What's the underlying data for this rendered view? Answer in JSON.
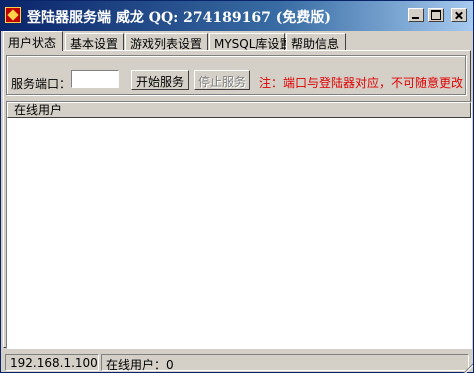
{
  "window": {
    "title": "登陆器服务端 威龙 QQ: 274189167 (免费版)"
  },
  "tabs": [
    {
      "label": "用户状态",
      "active": true
    },
    {
      "label": "基本设置",
      "active": false
    },
    {
      "label": "游戏列表设置",
      "active": false
    },
    {
      "label": "MYSQL库设置",
      "active": false
    },
    {
      "label": "帮助信息",
      "active": false
    }
  ],
  "server": {
    "port_label": "服务端口：",
    "port_value": "",
    "start_button": "开始服务",
    "stop_button": "停止服务",
    "stop_enabled": false,
    "note": "注：端口与登陆器对应，不可随意更改"
  },
  "online_list": {
    "columns": [
      "在线用户"
    ],
    "rows": []
  },
  "statusbar": {
    "ip": "192.168.1.100",
    "online_users": "在线用户：0"
  },
  "colors": {
    "titlebar_start": "#0a246a",
    "titlebar_end": "#a6caf0",
    "note_text": "#e00000"
  },
  "icons": [
    "app-icon",
    "minimize-icon",
    "maximize-icon",
    "close-icon"
  ]
}
